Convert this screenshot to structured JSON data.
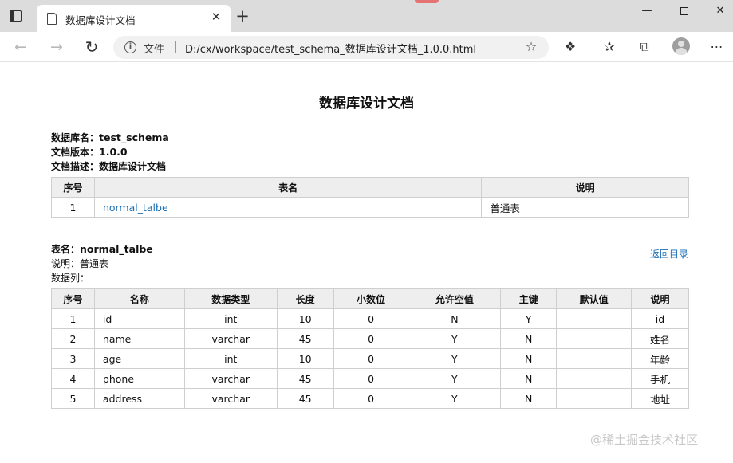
{
  "browser": {
    "tab_title": "数据库设计文档",
    "tab_close": "✕",
    "new_tab": "+",
    "url_scheme_label": "文件",
    "url": "D:/cx/workspace/test_schema_数据库设计文档_1.0.0.html"
  },
  "doc": {
    "title": "数据库设计文档",
    "db_name_label": "数据库名：",
    "db_name": "test_schema",
    "version_label": "文档版本：",
    "version": "1.0.0",
    "desc_label": "文档描述：",
    "desc": "数据库设计文档"
  },
  "toc": {
    "headers": [
      "序号",
      "表名",
      "说明"
    ],
    "rows": [
      {
        "no": "1",
        "name": "normal_talbe",
        "note": "普通表"
      }
    ]
  },
  "table_detail": {
    "name_label": "表名：",
    "name": "normal_talbe",
    "note_label": "说明：",
    "note": "普通表",
    "columns_label": "数据列：",
    "back_link": "返回目录",
    "headers": [
      "序号",
      "名称",
      "数据类型",
      "长度",
      "小数位",
      "允许空值",
      "主键",
      "默认值",
      "说明"
    ],
    "rows": [
      {
        "no": "1",
        "name": "id",
        "type": "int",
        "length": "10",
        "scale": "0",
        "nullable": "N",
        "pk": "Y",
        "default": "",
        "note": "id"
      },
      {
        "no": "2",
        "name": "name",
        "type": "varchar",
        "length": "45",
        "scale": "0",
        "nullable": "Y",
        "pk": "N",
        "default": "",
        "note": "姓名"
      },
      {
        "no": "3",
        "name": "age",
        "type": "int",
        "length": "10",
        "scale": "0",
        "nullable": "Y",
        "pk": "N",
        "default": "",
        "note": "年龄"
      },
      {
        "no": "4",
        "name": "phone",
        "type": "varchar",
        "length": "45",
        "scale": "0",
        "nullable": "Y",
        "pk": "N",
        "default": "",
        "note": "手机"
      },
      {
        "no": "5",
        "name": "address",
        "type": "varchar",
        "length": "45",
        "scale": "0",
        "nullable": "Y",
        "pk": "N",
        "default": "",
        "note": "地址"
      }
    ]
  },
  "watermark": "@稀土掘金技术社区"
}
